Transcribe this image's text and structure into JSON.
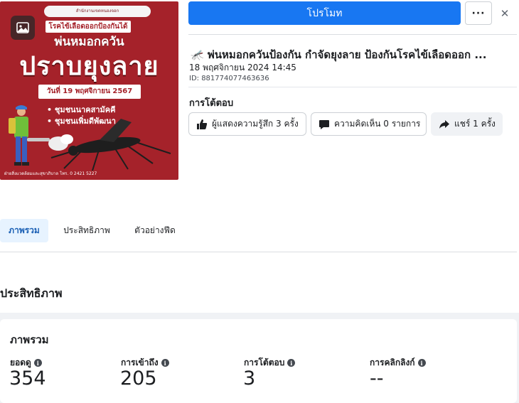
{
  "thumbnail": {
    "org_text": "สำนักงานเขตหนองจอก",
    "subtitle": "โรคไข้เลือดออกป้องกันได้",
    "heading1": "พ่นหมอกควัน",
    "heading2": "ปราบยุงลาย",
    "date_label": "วันที่ 19 พฤศจิกายน 2567",
    "bullets": [
      "ชุมชนนาคสามัคคี",
      "ชุมชนเพิ่มดีพัฒนา"
    ],
    "footer": "ฝ่ายสิ่งแวดล้อมและสุขาภิบาล โทร. 0 2421 5227"
  },
  "toolbar": {
    "promote_label": "โปรโมท",
    "more_label": "···",
    "close_label": "✕"
  },
  "post": {
    "title": "🦟 พ่นหมอกควันป้องกัน กำจัดยุงลาย ป้องกันโรคไข้เลือดออก ...",
    "date": "18 พฤศจิกายน 2024 14:45",
    "id": "ID: 881774077463636"
  },
  "engagement": {
    "title": "การโต้ตอบ",
    "reactions_label": "ผู้แสดงความรู้สึก 3 ครั้ง",
    "comments_label": "ความคิดเห็น 0 รายการ",
    "shares_label": "แชร์ 1 ครั้ง"
  },
  "tabs": [
    "ภาพรวม",
    "ประสิทธิภาพ",
    "ตัวอย่างฟีด"
  ],
  "performance": {
    "section_title": "ประสิทธิภาพ",
    "card_title": "ภาพรวม",
    "metrics": [
      {
        "label": "ยอดดู",
        "value": "354"
      },
      {
        "label": "การเข้าถึง",
        "value": "205"
      },
      {
        "label": "การโต้ตอบ",
        "value": "3"
      },
      {
        "label": "การคลิกลิงก์",
        "value": "--"
      }
    ]
  },
  "colors": {
    "accent": "#1877f2",
    "thumbnail_bg": "#a5222a",
    "tab_active_bg": "#e7f3ff",
    "tab_active_text": "#1a5fb4"
  }
}
